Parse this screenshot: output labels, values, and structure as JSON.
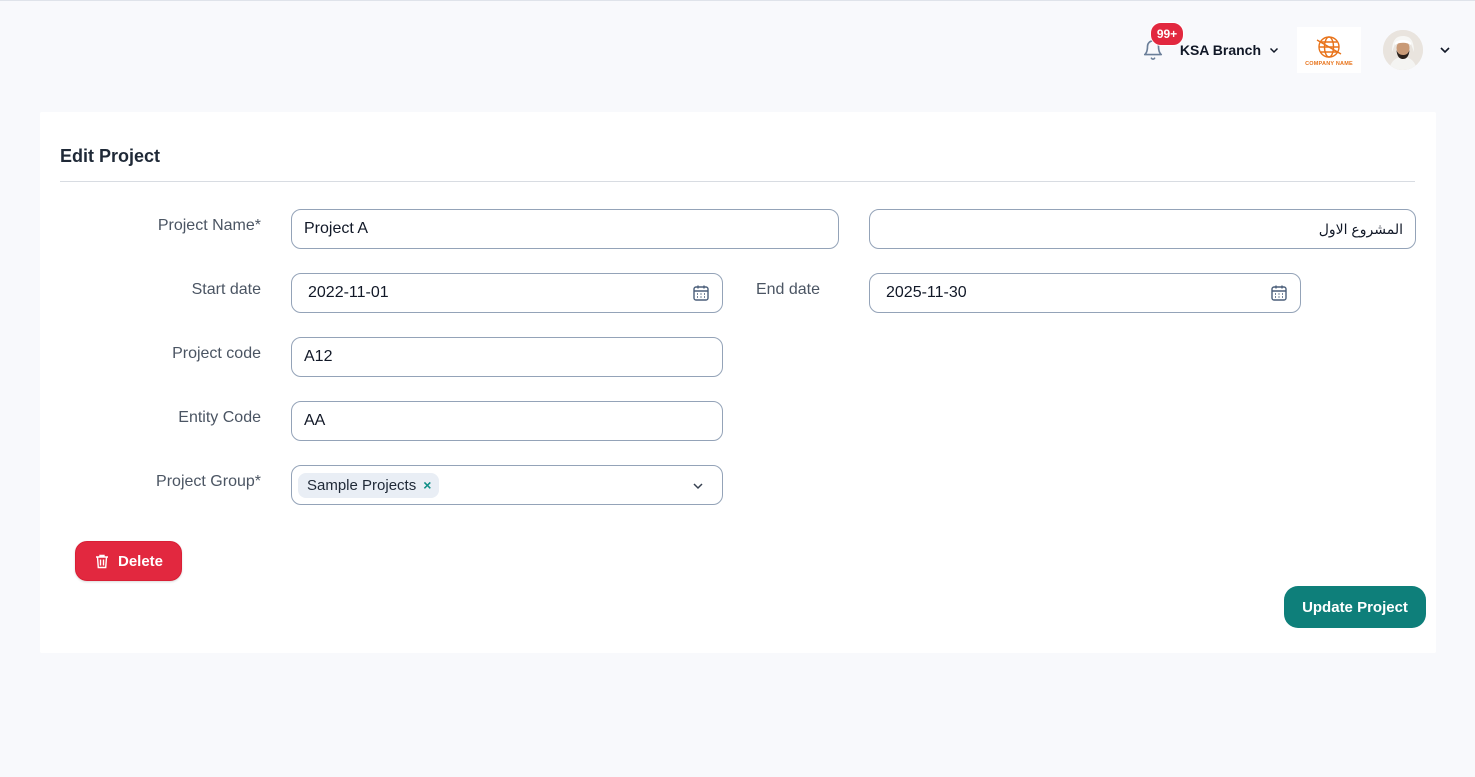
{
  "header": {
    "notification_count": "99+",
    "branch_label": "KSA Branch",
    "logo_text": "COMPANY NAME"
  },
  "form": {
    "title": "Edit Project",
    "project_name_label": "Project Name",
    "project_name_value": "Project A",
    "project_name_ar_value": "المشروع الاول",
    "start_date_label": "Start date",
    "start_date_value": "2022-11-01",
    "end_date_label": "End date",
    "end_date_value": "2025-11-30",
    "project_code_label": "Project code",
    "project_code_value": "A12",
    "entity_code_label": "Entity Code",
    "entity_code_value": "AA",
    "project_group_label": "Project Group",
    "project_group_tags": [
      "Sample Projects"
    ],
    "required_mark": "*"
  },
  "actions": {
    "delete_label": "Delete",
    "update_label": "Update Project"
  },
  "colors": {
    "danger": "#e2283f",
    "primary": "#0e7f7a",
    "background": "#f8f9fc"
  }
}
